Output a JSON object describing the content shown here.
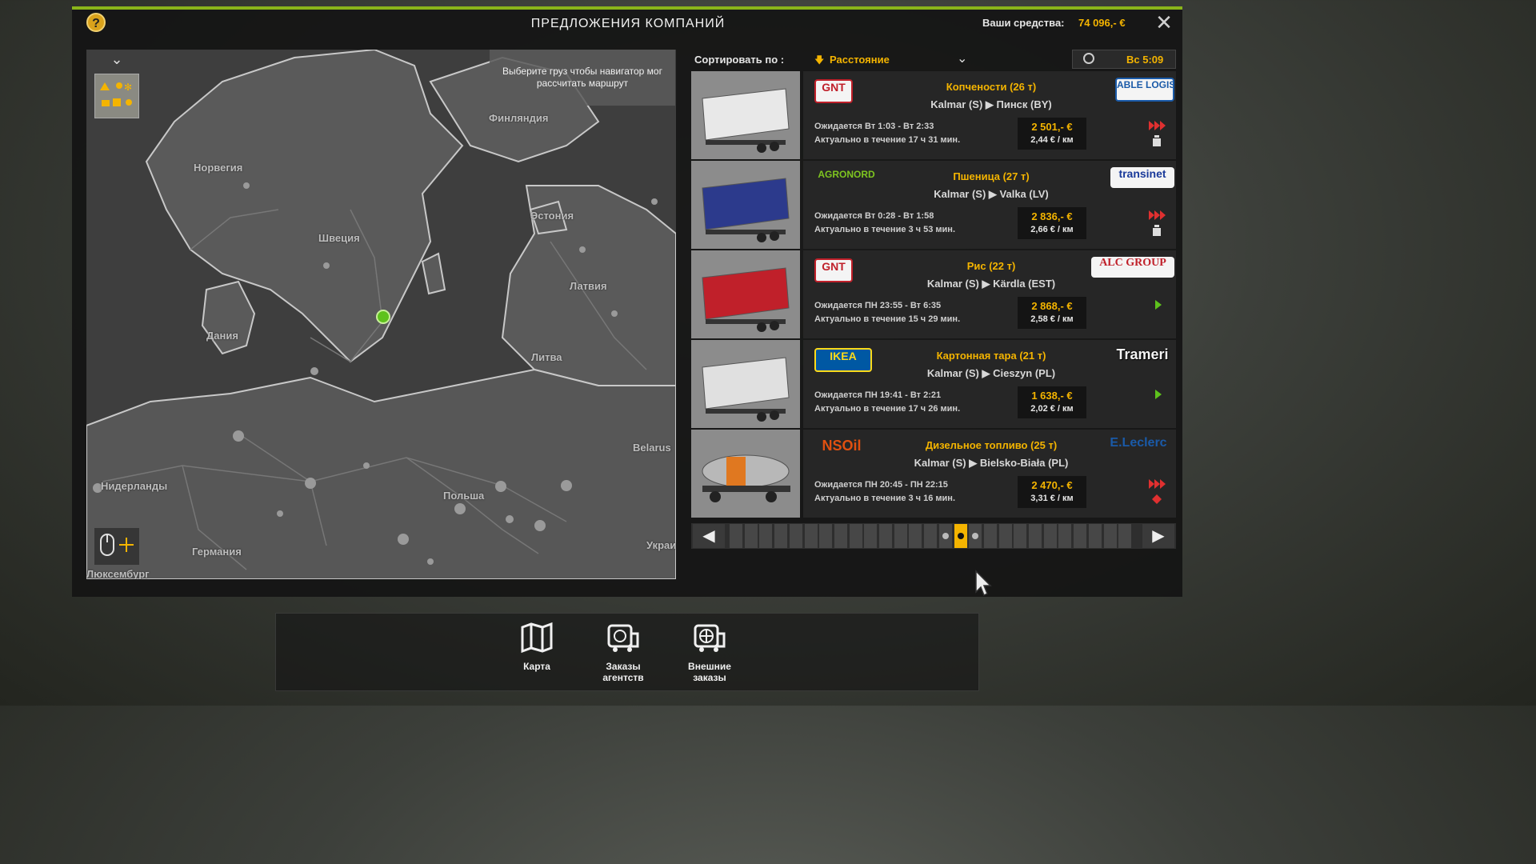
{
  "header": {
    "title": "ПРЕДЛОЖЕНИЯ КОМПАНИЙ",
    "funds_label": "Ваши средства:",
    "funds_value": "74 096,- €",
    "help_icon": "question-icon",
    "close_icon": "close-icon"
  },
  "map": {
    "hint": "Выберите груз чтобы навигатор мог рассчитать маршрут",
    "countries": [
      "Норвегия",
      "Финляндия",
      "Швеция",
      "Эстония",
      "Латвия",
      "Дания",
      "Литва",
      "Belarus",
      "Нидерланды",
      "Польша",
      "Германия",
      "Люксембург",
      "Украи"
    ]
  },
  "sort": {
    "label": "Сортировать по :",
    "value": "Расстояние"
  },
  "clock": {
    "icon": "clock-icon",
    "time": "Вс 5:09"
  },
  "jobs": [
    {
      "sender": "GNT",
      "receiver": "ABLE LOGISTICS",
      "cargo": "Копчености (26 т)",
      "route": "Kalmar (S) ▶ Пинск (BY)",
      "expected": "Ожидается Вт 1:03 - Вт 2:33",
      "valid": "Актуально в течение 17 ч 31 мин.",
      "price": "2 501,- €",
      "rate": "2,44 € / км",
      "urgency": "urgent",
      "cargo_icon": "fragile-icon"
    },
    {
      "sender": "AGRONORD",
      "receiver": "transinet",
      "cargo": "Пшеница (27 т)",
      "route": "Kalmar (S) ▶ Valka (LV)",
      "expected": "Ожидается Вт 0:28 - Вт 1:58",
      "valid": "Актуально в течение 3 ч 53 мин.",
      "price": "2 836,- €",
      "rate": "2,66 € / км",
      "urgency": "urgent",
      "cargo_icon": "fragile-icon"
    },
    {
      "sender": "GNT",
      "receiver": "ALC GROUP",
      "cargo": "Рис (22 т)",
      "route": "Kalmar (S) ▶ Kärdla (EST)",
      "expected": "Ожидается ПН 23:55 - Вт 6:35",
      "valid": "Актуально в течение 15 ч 29 мин.",
      "price": "2 868,- €",
      "rate": "2,58 € / км",
      "urgency": "normal",
      "cargo_icon": ""
    },
    {
      "sender": "IKEA",
      "receiver": "Trameri",
      "cargo": "Картонная тара (21 т)",
      "route": "Kalmar (S) ▶ Cieszyn (PL)",
      "expected": "Ожидается ПН 19:41 - Вт 2:21",
      "valid": "Актуально в течение 17 ч 26 мин.",
      "price": "1 638,- €",
      "rate": "2,02 € / км",
      "urgency": "normal",
      "cargo_icon": ""
    },
    {
      "sender": "NSOil",
      "receiver": "E.Leclerc",
      "cargo": "Дизельное топливо (25 т)",
      "route": "Kalmar (S) ▶ Bielsko-Biała (PL)",
      "expected": "Ожидается ПН 20:45 - ПН 22:15",
      "valid": "Актуально в течение 3 ч 16 мин.",
      "price": "2 470,- €",
      "rate": "3,31 € / км",
      "urgency": "urgent",
      "cargo_icon": "hazard-icon"
    }
  ],
  "pager": {
    "page_count": 27,
    "current_page": 15
  },
  "bottom_tabs": [
    {
      "label": "Карта",
      "icon": "map-icon"
    },
    {
      "label": "Заказы агентств",
      "icon": "agency-orders-icon"
    },
    {
      "label": "Внешние заказы",
      "icon": "external-orders-icon"
    }
  ],
  "colors": {
    "accent": "#f4b400",
    "top_border": "#8ab51a",
    "urgent": "#e03030",
    "normal": "#5ec21c"
  }
}
